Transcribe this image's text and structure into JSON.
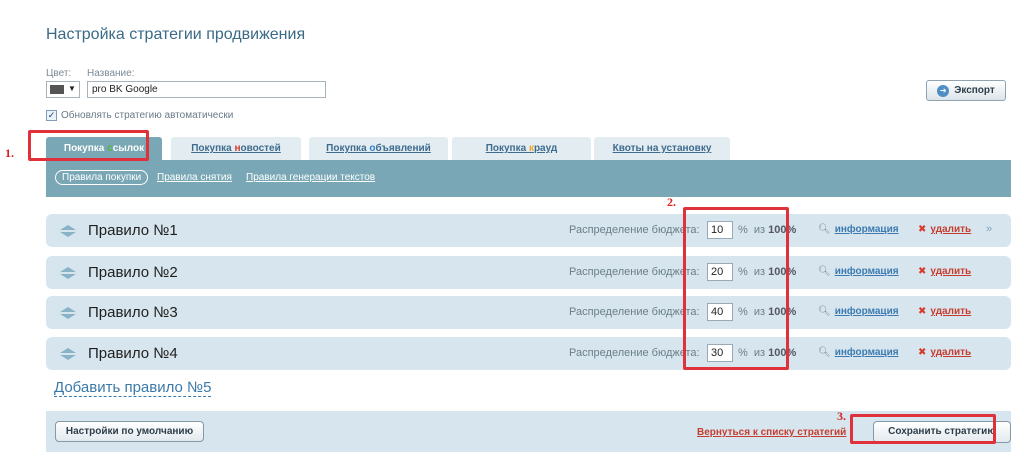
{
  "page": {
    "title": "Настройка стратегии продвижения"
  },
  "form": {
    "color_label": "Цвет:",
    "name_label": "Название:",
    "name_value": "pro BK Google",
    "auto_update_label": "Обновлять стратегию автоматически",
    "auto_update_checked": true,
    "color_value": "#555555"
  },
  "toolbar": {
    "export_label": "Экспорт"
  },
  "tabs": [
    {
      "pre": "Покупка ",
      "hl": "с",
      "post": "сылок",
      "active": true
    },
    {
      "pre": "Покупка ",
      "hl": "н",
      "post": "овостей",
      "active": false
    },
    {
      "pre": "Покупка ",
      "hl": "о",
      "post": "бъявлений",
      "active": false
    },
    {
      "pre": "Покупка ",
      "hl": "к",
      "post": "рауд",
      "active": false
    },
    {
      "pre": "Квоты на установку",
      "hl": "",
      "post": "",
      "active": false
    }
  ],
  "subnav": {
    "items": [
      "Правила покупки",
      "Правила снятия",
      "Правила генерации текстов"
    ]
  },
  "rules": [
    {
      "name": "Правило №1",
      "budget": "10"
    },
    {
      "name": "Правило №2",
      "budget": "20"
    },
    {
      "name": "Правило №3",
      "budget": "40"
    },
    {
      "name": "Правило №4",
      "budget": "30"
    }
  ],
  "rule_labels": {
    "budget_label": "Распределение бюджета:",
    "percent_sign": "%",
    "of_label": "из",
    "total": "100%",
    "info_label": "информация",
    "delete_label": "удалить",
    "more_icon": "»"
  },
  "add_rule_label": "Добавить правило №5",
  "footer": {
    "default_label": "Настройки по умолчанию",
    "back_label": "Вернуться к списку стратегий",
    "save_label": "Сохранить стратегию"
  },
  "annotations": [
    "1.",
    "2.",
    "3."
  ],
  "colors": {
    "accent": "#79a7b5",
    "rule_bg": "#d7e6ee",
    "annotation": "#e0303a",
    "link": "#3c7ab0",
    "danger": "#c63d2f"
  }
}
